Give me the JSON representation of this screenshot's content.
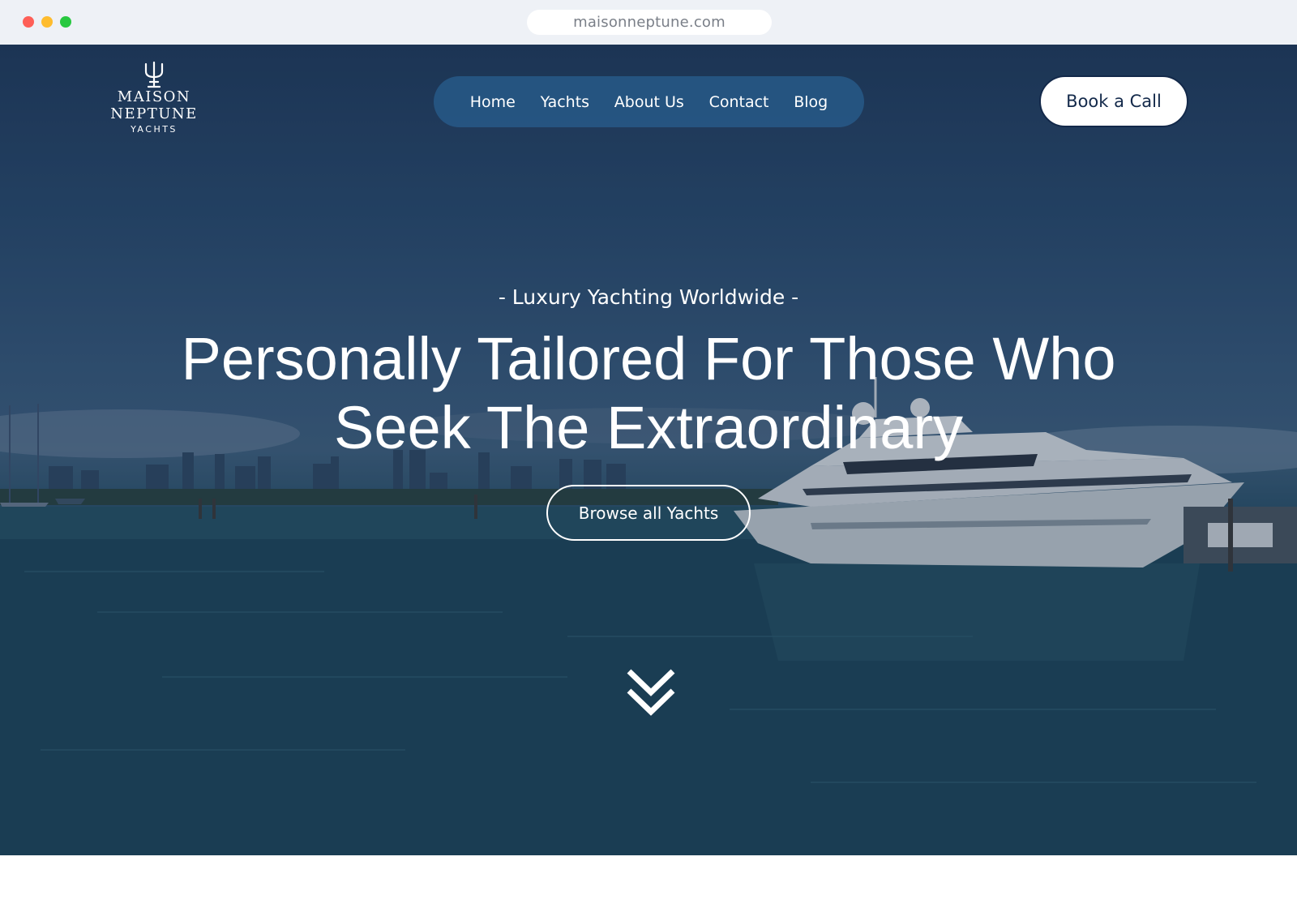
{
  "browser": {
    "url": "maisonneptune.com"
  },
  "logo": {
    "line1": "MAISON",
    "line2": "NEPTUNE",
    "line3": "YACHTS",
    "icon": "trident-icon"
  },
  "nav": {
    "items": [
      {
        "label": "Home"
      },
      {
        "label": "Yachts"
      },
      {
        "label": "About Us"
      },
      {
        "label": "Contact"
      },
      {
        "label": "Blog"
      }
    ]
  },
  "header": {
    "cta_label": "Book a Call"
  },
  "hero": {
    "eyebrow": "- Luxury Yachting Worldwide -",
    "headline_line1": "Personally Tailored For Those Who",
    "headline_line2": "Seek The Extraordinary",
    "button_label": "Browse all Yachts",
    "scroll_icon": "double-chevron-down-icon"
  },
  "colors": {
    "nav_bg": "#2b5c8c",
    "cta_text": "#13294a",
    "water": "#1b4558",
    "sky": "#294b6e"
  }
}
